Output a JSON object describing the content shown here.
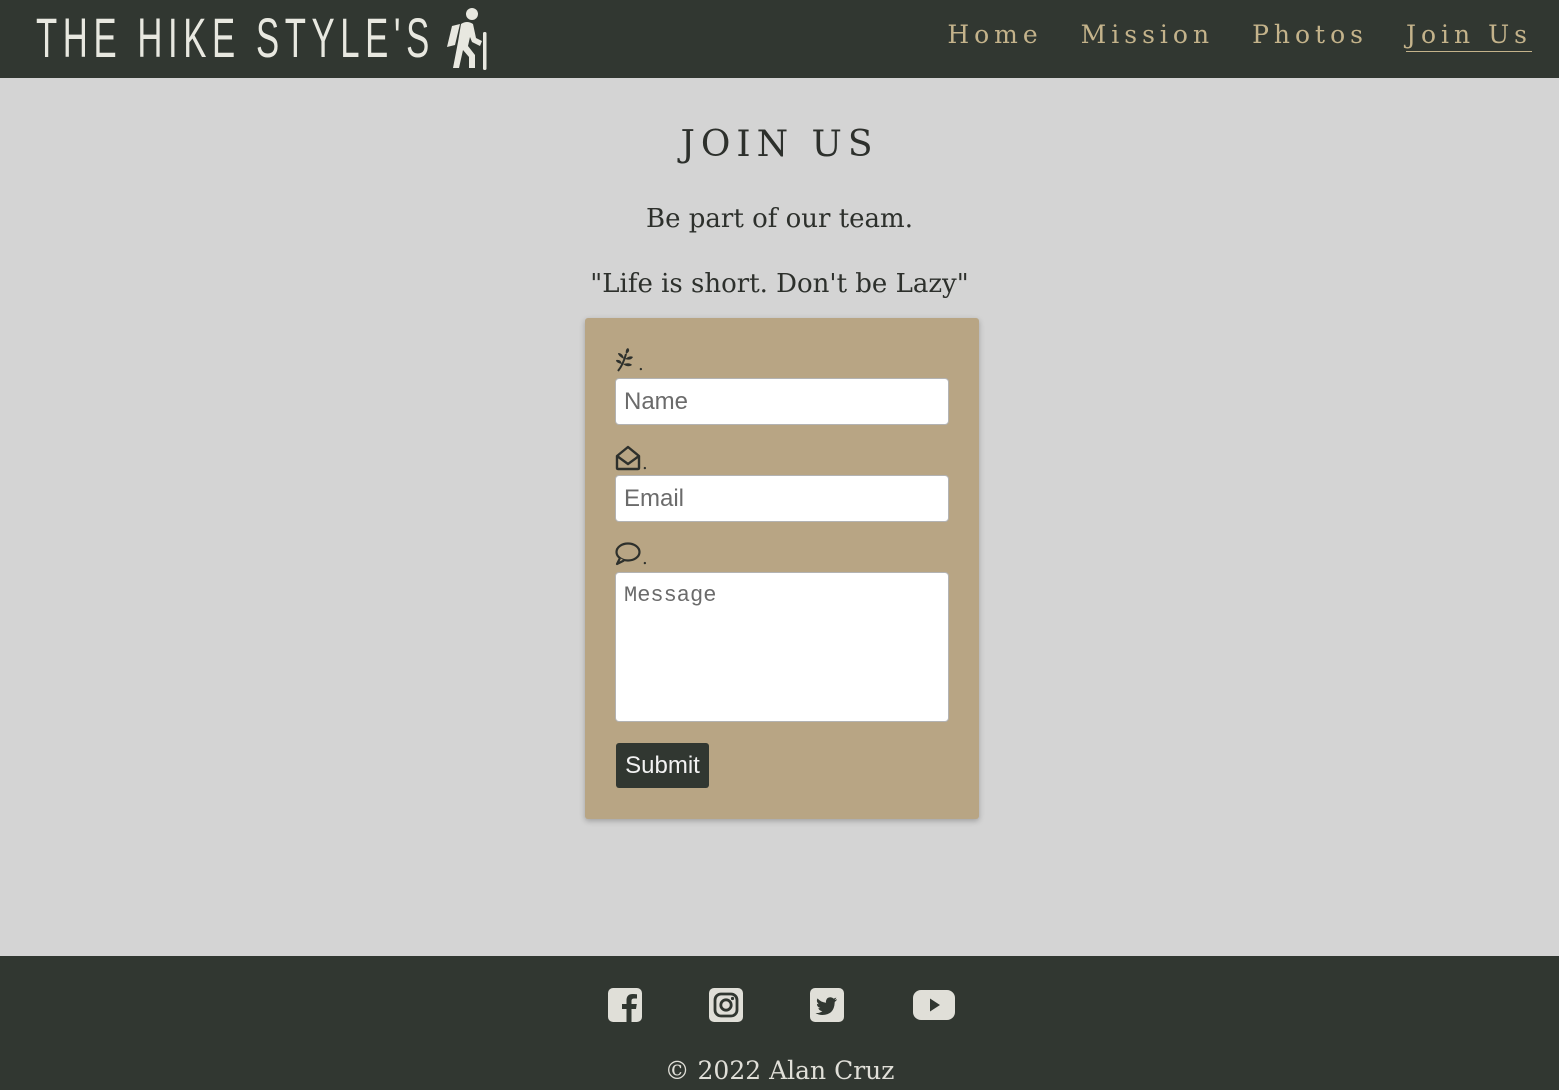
{
  "header": {
    "brand": "THE HIKE STYLE'S",
    "logo_icon": "hiker-icon",
    "nav": [
      {
        "label": "Home",
        "active": false
      },
      {
        "label": "Mission",
        "active": false
      },
      {
        "label": "Photos",
        "active": false
      },
      {
        "label": "Join Us",
        "active": true
      }
    ]
  },
  "main": {
    "title": "JOIN US",
    "subtitle": "Be part of our team.",
    "quote": "\"Life is short. Don't be Lazy\""
  },
  "form": {
    "name_icon": "leaf-icon",
    "name_placeholder": "Name",
    "email_icon": "envelope-open-icon",
    "email_placeholder": "Email",
    "message_icon": "comment-icon",
    "message_placeholder": "Message",
    "submit_label": "Submit"
  },
  "footer": {
    "social_icons": [
      "facebook-icon",
      "instagram-icon",
      "twitter-icon",
      "youtube-icon"
    ],
    "copyright": "© 2022 Alan Cruz"
  },
  "colors": {
    "header_bg": "#313731",
    "page_bg": "#d4d4d4",
    "card_bg": "#b8a584",
    "nav_text": "#c4b38b",
    "button_bg": "#313731"
  }
}
